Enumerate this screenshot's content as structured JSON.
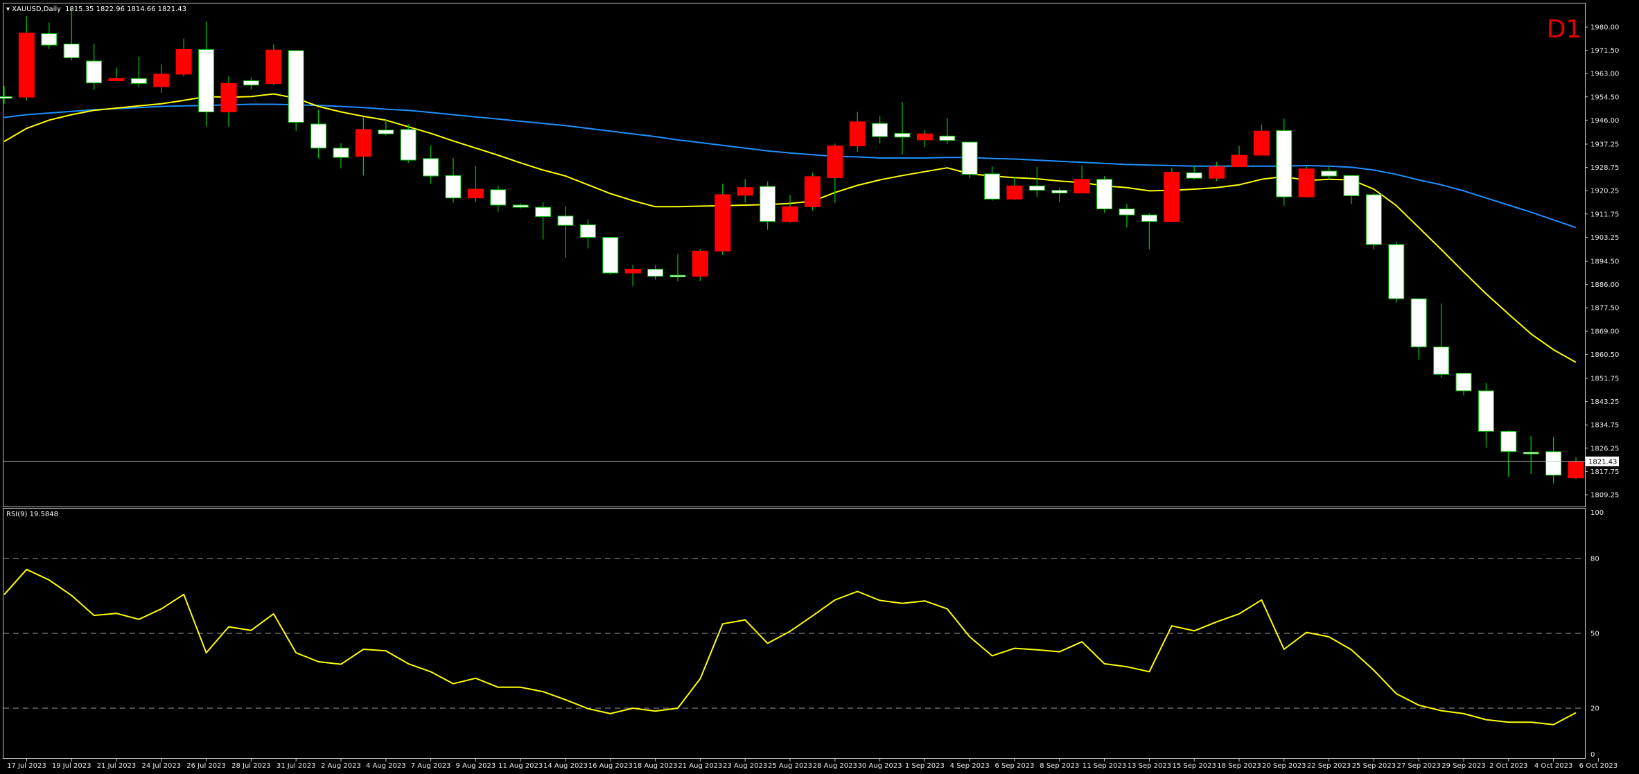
{
  "header": {
    "symbol_label": "XAUUSD,Daily",
    "ohlc_text": "1815.35 1822.96 1814.66 1821.43",
    "timeframe": "D1"
  },
  "rsi_panel": {
    "label": "RSI(9) 19.5848"
  },
  "colors": {
    "background": "#000000",
    "bull_body": "#ffffff",
    "bear_body": "#ff0000",
    "wick": "#00c000",
    "ma_fast": "#ffff00",
    "ma_slow": "#1e90ff",
    "rsi_line": "#ffff00",
    "level_line": "#a0a0a0",
    "price_line": "#c0c0c0",
    "tf_label": "#e00000"
  },
  "chart_data": [
    {
      "type": "candlestick",
      "title": "XAUUSD,Daily",
      "ylim": [
        1804.95,
        1988.6
      ],
      "y_ticks": [
        "1980.00",
        "1971.50",
        "1963.00",
        "1954.50",
        "1946.00",
        "1937.25",
        "1928.75",
        "1920.25",
        "1911.75",
        "1903.25",
        "1894.50",
        "1886.00",
        "1877.50",
        "1869.00",
        "1860.50",
        "1851.75",
        "1843.25",
        "1834.75",
        "1826.25",
        "1817.75",
        "1809.25"
      ],
      "current_price": "1821.43",
      "x_tick_labels": [
        {
          "index": 1,
          "label": "17 Jul 2023"
        },
        {
          "index": 3,
          "label": "19 Jul 2023"
        },
        {
          "index": 5,
          "label": "21 Jul 2023"
        },
        {
          "index": 7,
          "label": "24 Jul 2023"
        },
        {
          "index": 9,
          "label": "26 Jul 2023"
        },
        {
          "index": 11,
          "label": "28 Jul 2023"
        },
        {
          "index": 13,
          "label": "31 Jul 2023"
        },
        {
          "index": 15,
          "label": "2 Aug 2023"
        },
        {
          "index": 17,
          "label": "4 Aug 2023"
        },
        {
          "index": 19,
          "label": "7 Aug 2023"
        },
        {
          "index": 21,
          "label": "9 Aug 2023"
        },
        {
          "index": 23,
          "label": "11 Aug 2023"
        },
        {
          "index": 25,
          "label": "14 Aug 2023"
        },
        {
          "index": 27,
          "label": "16 Aug 2023"
        },
        {
          "index": 29,
          "label": "18 Aug 2023"
        },
        {
          "index": 31,
          "label": "21 Aug 2023"
        },
        {
          "index": 33,
          "label": "23 Aug 2023"
        },
        {
          "index": 35,
          "label": "25 Aug 2023"
        },
        {
          "index": 37,
          "label": "28 Aug 2023"
        },
        {
          "index": 39,
          "label": "30 Aug 2023"
        },
        {
          "index": 41,
          "label": "1 Sep 2023"
        },
        {
          "index": 43,
          "label": "4 Sep 2023"
        },
        {
          "index": 45,
          "label": "6 Sep 2023"
        },
        {
          "index": 47,
          "label": "8 Sep 2023"
        },
        {
          "index": 49,
          "label": "11 Sep 2023"
        },
        {
          "index": 51,
          "label": "13 Sep 2023"
        },
        {
          "index": 53,
          "label": "15 Sep 2023"
        },
        {
          "index": 55,
          "label": "18 Sep 2023"
        },
        {
          "index": 57,
          "label": "20 Sep 2023"
        },
        {
          "index": 59,
          "label": "22 Sep 2023"
        },
        {
          "index": 61,
          "label": "25 Sep 2023"
        },
        {
          "index": 63,
          "label": "27 Sep 2023"
        },
        {
          "index": 65,
          "label": "29 Sep 2023"
        },
        {
          "index": 67,
          "label": "2 Oct 2023"
        },
        {
          "index": 69,
          "label": "4 Oct 2023"
        },
        {
          "index": 71,
          "label": "6 Oct 2023"
        }
      ],
      "candles": [
        {
          "o": 1954.6,
          "h": 1958.5,
          "l": 1952.0,
          "c": 1954.6
        },
        {
          "o": 1977.8,
          "h": 1984.0,
          "l": 1953.2,
          "c": 1954.4
        },
        {
          "o": 1973.4,
          "h": 1981.6,
          "l": 1972.0,
          "c": 1977.6
        },
        {
          "o": 1968.8,
          "h": 1986.8,
          "l": 1967.8,
          "c": 1973.8
        },
        {
          "o": 1959.6,
          "h": 1974.0,
          "l": 1957.0,
          "c": 1967.6
        },
        {
          "o": 1961.2,
          "h": 1965.2,
          "l": 1960.4,
          "c": 1960.4
        },
        {
          "o": 1959.4,
          "h": 1969.2,
          "l": 1958.0,
          "c": 1961.2
        },
        {
          "o": 1962.8,
          "h": 1966.4,
          "l": 1956.0,
          "c": 1958.2
        },
        {
          "o": 1971.8,
          "h": 1975.8,
          "l": 1962.0,
          "c": 1962.8
        },
        {
          "o": 1949.0,
          "h": 1982.0,
          "l": 1943.6,
          "c": 1971.8
        },
        {
          "o": 1959.4,
          "h": 1962.0,
          "l": 1943.6,
          "c": 1949.0
        },
        {
          "o": 1958.8,
          "h": 1961.6,
          "l": 1957.2,
          "c": 1960.4
        },
        {
          "o": 1971.6,
          "h": 1973.6,
          "l": 1958.8,
          "c": 1959.4
        },
        {
          "o": 1945.2,
          "h": 1971.6,
          "l": 1942.0,
          "c": 1971.4
        },
        {
          "o": 1935.8,
          "h": 1949.8,
          "l": 1932.0,
          "c": 1944.6
        },
        {
          "o": 1932.4,
          "h": 1937.6,
          "l": 1928.4,
          "c": 1935.8
        },
        {
          "o": 1942.6,
          "h": 1947.2,
          "l": 1925.8,
          "c": 1932.8
        },
        {
          "o": 1941.0,
          "h": 1946.4,
          "l": 1940.4,
          "c": 1942.4
        },
        {
          "o": 1931.4,
          "h": 1944.6,
          "l": 1930.4,
          "c": 1942.6
        },
        {
          "o": 1925.6,
          "h": 1936.8,
          "l": 1922.8,
          "c": 1932.0
        },
        {
          "o": 1917.6,
          "h": 1932.2,
          "l": 1915.8,
          "c": 1925.8
        },
        {
          "o": 1920.8,
          "h": 1929.2,
          "l": 1916.0,
          "c": 1917.6
        },
        {
          "o": 1915.0,
          "h": 1922.0,
          "l": 1912.6,
          "c": 1920.6
        },
        {
          "o": 1914.2,
          "h": 1915.6,
          "l": 1913.8,
          "c": 1915.0
        },
        {
          "o": 1910.8,
          "h": 1916.0,
          "l": 1902.4,
          "c": 1914.2
        },
        {
          "o": 1907.6,
          "h": 1914.6,
          "l": 1895.8,
          "c": 1911.0
        },
        {
          "o": 1903.2,
          "h": 1909.8,
          "l": 1899.2,
          "c": 1907.8
        },
        {
          "o": 1890.2,
          "h": 1903.4,
          "l": 1889.6,
          "c": 1903.2
        },
        {
          "o": 1891.6,
          "h": 1893.2,
          "l": 1885.4,
          "c": 1890.2
        },
        {
          "o": 1889.0,
          "h": 1893.2,
          "l": 1887.8,
          "c": 1891.6
        },
        {
          "o": 1889.4,
          "h": 1897.2,
          "l": 1887.2,
          "c": 1889.4
        },
        {
          "o": 1898.2,
          "h": 1899.0,
          "l": 1887.2,
          "c": 1889.0
        },
        {
          "o": 1918.8,
          "h": 1922.8,
          "l": 1896.8,
          "c": 1898.2
        },
        {
          "o": 1921.4,
          "h": 1924.6,
          "l": 1916.0,
          "c": 1918.6
        },
        {
          "o": 1909.0,
          "h": 1923.6,
          "l": 1906.0,
          "c": 1921.8
        },
        {
          "o": 1914.4,
          "h": 1918.6,
          "l": 1908.6,
          "c": 1909.0
        },
        {
          "o": 1925.4,
          "h": 1926.8,
          "l": 1913.0,
          "c": 1914.4
        },
        {
          "o": 1936.6,
          "h": 1937.4,
          "l": 1915.8,
          "c": 1925.0
        },
        {
          "o": 1945.4,
          "h": 1949.0,
          "l": 1934.4,
          "c": 1936.6
        },
        {
          "o": 1940.0,
          "h": 1947.6,
          "l": 1937.4,
          "c": 1944.8
        },
        {
          "o": 1939.8,
          "h": 1952.6,
          "l": 1933.4,
          "c": 1941.2
        },
        {
          "o": 1941.0,
          "h": 1942.4,
          "l": 1936.2,
          "c": 1938.8
        },
        {
          "o": 1938.6,
          "h": 1946.8,
          "l": 1937.2,
          "c": 1940.2
        },
        {
          "o": 1926.2,
          "h": 1938.0,
          "l": 1924.8,
          "c": 1938.0
        },
        {
          "o": 1917.2,
          "h": 1929.2,
          "l": 1916.6,
          "c": 1926.4
        },
        {
          "o": 1922.0,
          "h": 1925.2,
          "l": 1916.8,
          "c": 1917.2
        },
        {
          "o": 1920.4,
          "h": 1929.0,
          "l": 1917.8,
          "c": 1922.0
        },
        {
          "o": 1919.4,
          "h": 1921.4,
          "l": 1916.0,
          "c": 1920.4
        },
        {
          "o": 1924.4,
          "h": 1929.4,
          "l": 1919.4,
          "c": 1919.4
        },
        {
          "o": 1913.6,
          "h": 1925.6,
          "l": 1912.2,
          "c": 1924.4
        },
        {
          "o": 1911.4,
          "h": 1915.4,
          "l": 1906.8,
          "c": 1913.6
        },
        {
          "o": 1909.0,
          "h": 1912.0,
          "l": 1898.8,
          "c": 1911.4
        },
        {
          "o": 1927.0,
          "h": 1928.6,
          "l": 1909.0,
          "c": 1909.0
        },
        {
          "o": 1924.8,
          "h": 1929.2,
          "l": 1924.2,
          "c": 1926.8
        },
        {
          "o": 1929.0,
          "h": 1930.8,
          "l": 1923.8,
          "c": 1924.8
        },
        {
          "o": 1933.2,
          "h": 1936.6,
          "l": 1929.0,
          "c": 1929.0
        },
        {
          "o": 1942.0,
          "h": 1944.4,
          "l": 1933.2,
          "c": 1933.2
        },
        {
          "o": 1918.0,
          "h": 1946.6,
          "l": 1914.8,
          "c": 1942.2
        },
        {
          "o": 1928.2,
          "h": 1929.0,
          "l": 1917.8,
          "c": 1918.0
        },
        {
          "o": 1925.6,
          "h": 1929.0,
          "l": 1924.2,
          "c": 1927.4
        },
        {
          "o": 1918.4,
          "h": 1925.6,
          "l": 1915.4,
          "c": 1925.8
        },
        {
          "o": 1900.6,
          "h": 1919.6,
          "l": 1898.8,
          "c": 1918.8
        },
        {
          "o": 1880.8,
          "h": 1901.6,
          "l": 1879.4,
          "c": 1900.6
        },
        {
          "o": 1863.2,
          "h": 1880.8,
          "l": 1858.6,
          "c": 1880.8
        },
        {
          "o": 1853.2,
          "h": 1879.0,
          "l": 1852.0,
          "c": 1863.2
        },
        {
          "o": 1847.2,
          "h": 1853.8,
          "l": 1845.6,
          "c": 1853.6
        },
        {
          "o": 1832.4,
          "h": 1850.0,
          "l": 1826.4,
          "c": 1847.2
        },
        {
          "o": 1825.0,
          "h": 1832.8,
          "l": 1815.8,
          "c": 1832.4
        },
        {
          "o": 1824.2,
          "h": 1830.8,
          "l": 1816.8,
          "c": 1824.8
        },
        {
          "o": 1816.4,
          "h": 1830.4,
          "l": 1813.4,
          "c": 1825.0
        },
        {
          "o": 1821.4,
          "h": 1823.0,
          "l": 1815.0,
          "c": 1815.4
        }
      ],
      "series": [
        {
          "values": [
            1938.2,
            1943.0,
            1946.0,
            1948.0,
            1949.6,
            1950.4,
            1951.2,
            1952.0,
            1953.2,
            1954.6,
            1954.4,
            1954.6,
            1955.6,
            1954.0,
            1951.0,
            1949.0,
            1947.4,
            1946.0,
            1943.6,
            1941.2,
            1938.4,
            1935.8,
            1933.2,
            1930.4,
            1927.8,
            1925.6,
            1922.4,
            1919.2,
            1916.6,
            1914.4,
            1914.4,
            1914.6,
            1914.8,
            1915.0,
            1915.2,
            1915.6,
            1916.4,
            1919.6,
            1922.2,
            1924.2,
            1925.8,
            1927.2,
            1928.6,
            1926.4,
            1925.6,
            1925.0,
            1924.6,
            1923.8,
            1923.2,
            1922.0,
            1921.4,
            1920.2,
            1920.4,
            1920.8,
            1921.4,
            1922.4,
            1924.4,
            1925.4,
            1924.0,
            1924.4,
            1924.2,
            1920.8,
            1914.8,
            1906.8,
            1898.8,
            1890.6,
            1882.6,
            1875.2,
            1868.0,
            1862.2,
            1857.6
          ]
        },
        {
          "values": [
            1947.0,
            1948.0,
            1948.6,
            1949.2,
            1949.8,
            1950.2,
            1950.6,
            1951.0,
            1951.2,
            1951.4,
            1951.6,
            1951.8,
            1951.8,
            1951.6,
            1951.4,
            1951.0,
            1950.6,
            1950.0,
            1949.6,
            1948.8,
            1948.0,
            1947.2,
            1946.4,
            1945.6,
            1944.8,
            1944.0,
            1943.0,
            1942.0,
            1941.0,
            1940.0,
            1938.8,
            1937.8,
            1936.8,
            1935.8,
            1934.8,
            1934.0,
            1933.4,
            1932.8,
            1932.6,
            1932.2,
            1932.2,
            1932.2,
            1932.4,
            1932.4,
            1932.0,
            1931.8,
            1931.4,
            1931.0,
            1930.6,
            1930.2,
            1929.8,
            1929.6,
            1929.4,
            1929.2,
            1929.2,
            1929.2,
            1929.2,
            1929.2,
            1929.4,
            1929.2,
            1928.8,
            1927.8,
            1926.2,
            1924.2,
            1922.4,
            1920.2,
            1917.6,
            1915.0,
            1912.4,
            1909.6,
            1906.8
          ]
        }
      ]
    },
    {
      "type": "line",
      "title": "RSI(9) 19.5848",
      "ylim": [
        0,
        100
      ],
      "y_ticks": [
        100,
        80,
        50,
        20,
        0
      ],
      "levels": [
        80,
        50,
        20
      ],
      "series": [
        {
          "values": [
            65.5,
            75.6,
            71.4,
            65.2,
            57.2,
            58.0,
            55.6,
            59.8,
            65.6,
            42.2,
            52.6,
            51.2,
            57.8,
            42.2,
            38.6,
            37.6,
            43.6,
            43.0,
            37.8,
            34.6,
            29.8,
            32.0,
            28.4,
            28.4,
            26.6,
            23.4,
            19.8,
            17.8,
            20.0,
            18.8,
            20.0,
            31.8,
            53.8,
            55.4,
            46.0,
            50.8,
            57.0,
            63.4,
            66.8,
            63.2,
            62.0,
            63.0,
            59.8,
            48.6,
            41.0,
            44.0,
            43.4,
            42.6,
            46.6,
            37.8,
            36.6,
            34.6,
            53.0,
            51.0,
            54.6,
            57.8,
            63.4,
            43.6,
            50.4,
            48.6,
            43.4,
            35.2,
            25.8,
            21.2,
            19.0,
            17.8,
            15.4,
            14.4,
            14.4,
            13.4,
            18.2
          ]
        }
      ]
    }
  ]
}
